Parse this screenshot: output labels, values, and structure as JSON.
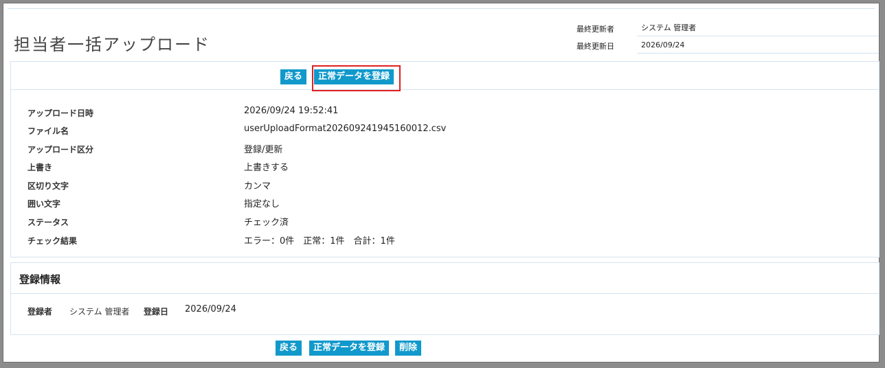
{
  "page_title": "担当者一括アップロード",
  "meta": {
    "updated_by_label": "最終更新者",
    "updated_by_value": "システム 管理者",
    "updated_date_label": "最終更新日",
    "updated_date_value": "2026/09/24"
  },
  "buttons": {
    "back": "戻る",
    "register_valid": "正常データを登録",
    "delete": "削除"
  },
  "details": [
    {
      "label": "アップロード日時",
      "value": "2026/09/24 19:52:41"
    },
    {
      "label": "ファイル名",
      "value": "userUploadFormat202609241945160012.csv"
    },
    {
      "label": "アップロード区分",
      "value": "登録/更新"
    },
    {
      "label": "上書き",
      "value": "上書きする"
    },
    {
      "label": "区切り文字",
      "value": "カンマ"
    },
    {
      "label": "囲い文字",
      "value": "指定なし"
    },
    {
      "label": "ステータス",
      "value": "チェック済"
    },
    {
      "label": "チェック結果",
      "value": "エラー：0件　正常：1件　合計：1件"
    }
  ],
  "registration": {
    "title": "登録情報",
    "registrant_label": "登録者",
    "registrant_value": "システム 管理者",
    "date_label": "登録日",
    "date_value": "2026/09/24"
  },
  "colors": {
    "button_bg": "#1199cc",
    "highlight_border": "#e02020",
    "divider": "#d4e3ef"
  }
}
